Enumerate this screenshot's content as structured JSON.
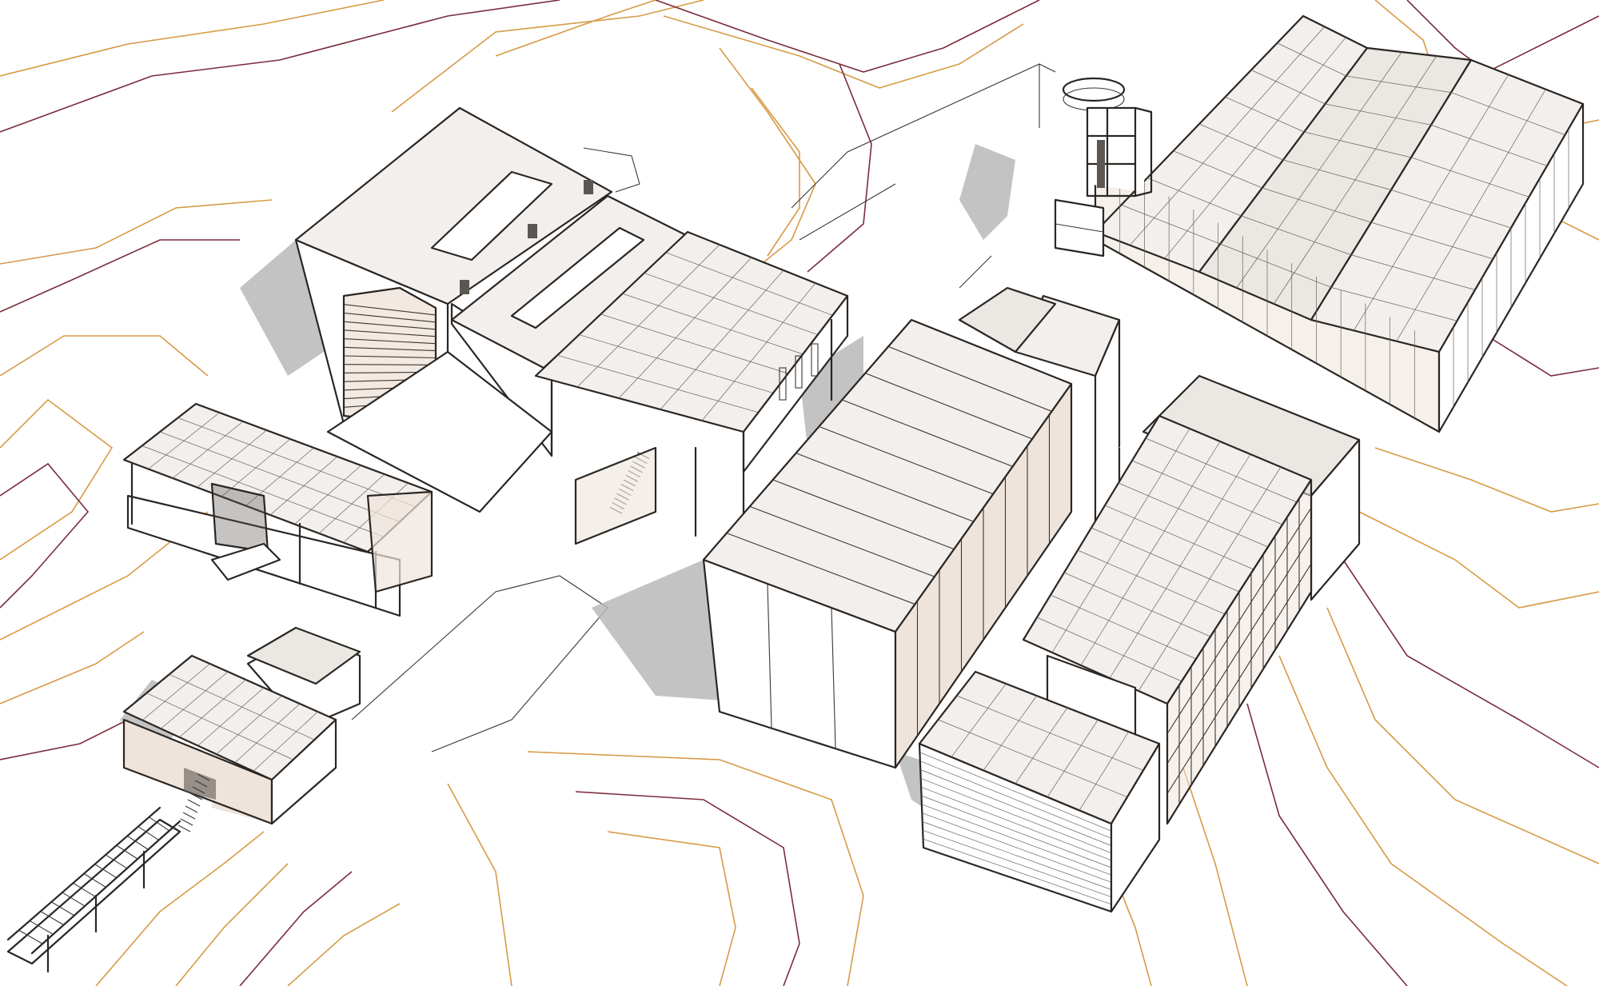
{
  "drawing": {
    "kind": "axonometric architectural sketch",
    "colors": {
      "ink": "#2a2623",
      "contour_orange": "#d79a46",
      "contour_maroon": "#7a2c3c",
      "shadow": "#b8b8b8",
      "roof_panel": "#f2efec",
      "warm_wall": "#efe4db"
    },
    "elements": [
      "terrain-contours",
      "tower-building",
      "courtyard-canopy",
      "west-pavilion",
      "central-hall",
      "east-wing",
      "greenhouse-sheds",
      "lookout-tower",
      "small-pavilion",
      "conveyor-bridge",
      "cast-shadows"
    ]
  }
}
